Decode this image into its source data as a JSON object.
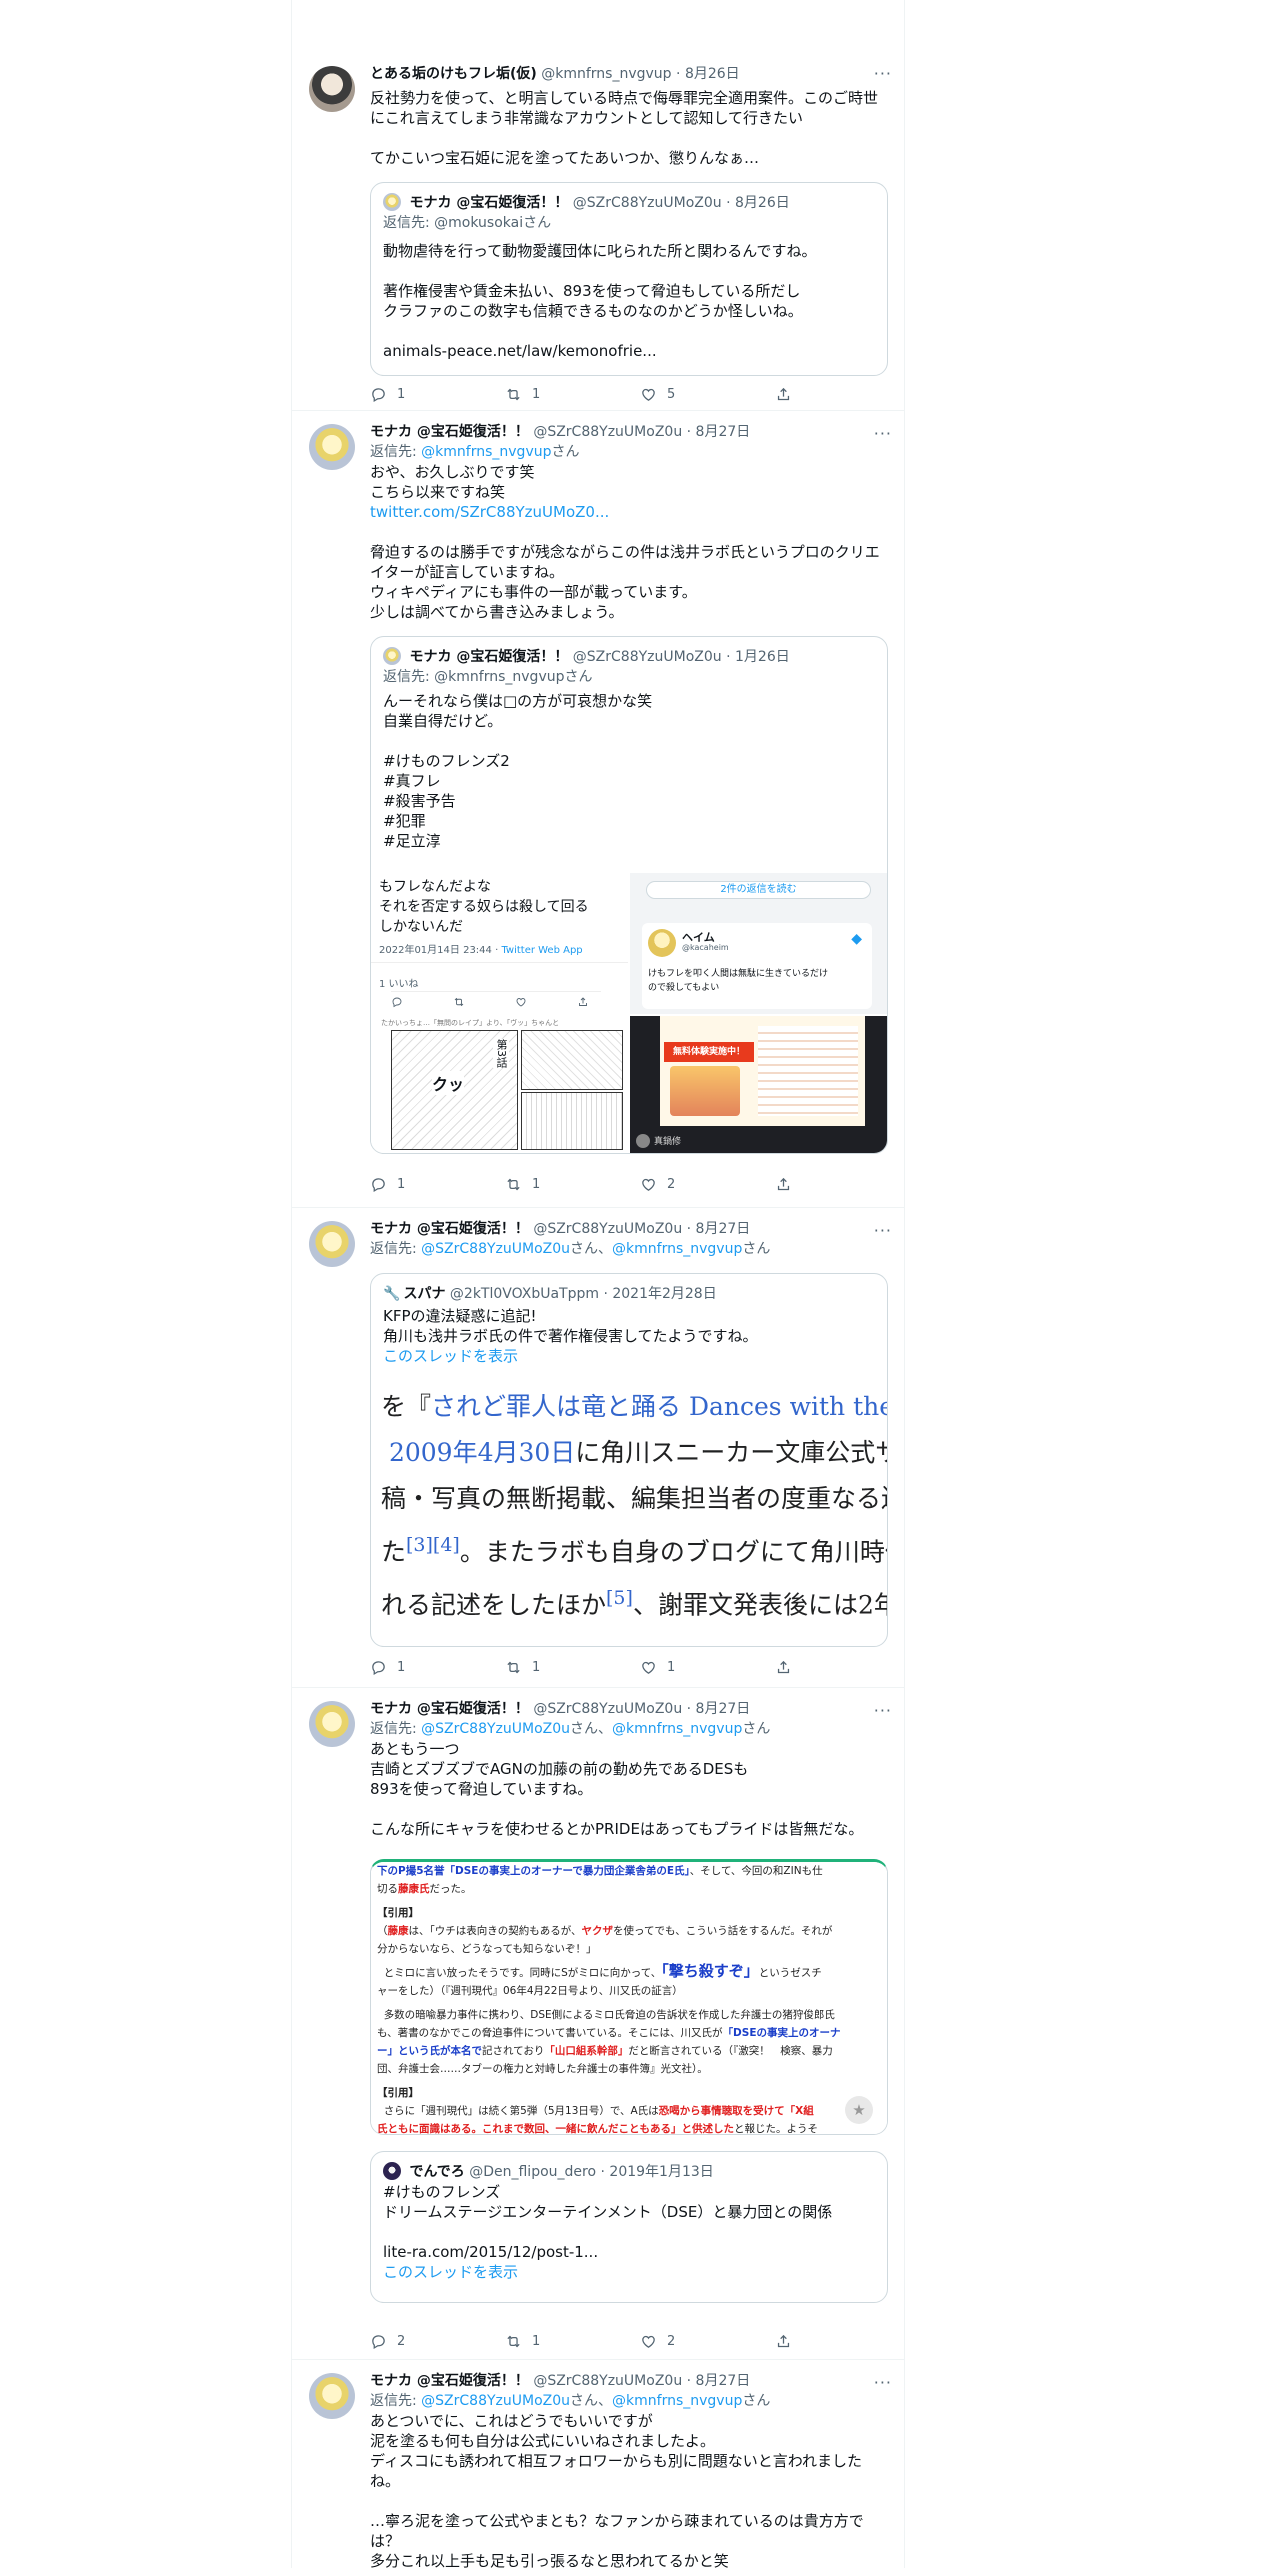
{
  "tweets": [
    {
      "name": "とある垢のけもフレ垢(仮)",
      "handle": "@kmnfrns_nvgvup",
      "date": "8月26日",
      "text": "反社勢力を使って、と明言している時点で侮辱罪完全適用案件。このご時世にこれ言えてしまう非常識なアカウントとして認知して行きたい\n\nてかこいつ宝石姫に泥を塗ってたあいつか、懲りんなぁ…",
      "quote": {
        "name": "モナカ @宝石姫復活！！",
        "handle": "@SZrC88YzuUMoZ0u",
        "date": "8月26日",
        "reply_to_prefix": "返信先: ",
        "reply_to": "@mokusokai",
        "reply_suffix": "さん",
        "text": "動物虐待を行って動物愛護団体に叱られた所と関わるんですね。\n\n著作権侵害や賃金未払い、893を使って脅迫もしている所だし\nクラファのこの数字も信頼できるものなのかどうか怪しいね。\n\nanimals-peace.net/law/kemonofrie..."
      },
      "counts": {
        "reply": "1",
        "retweet": "1",
        "like": "5"
      }
    },
    {
      "name": "モナカ @宝石姫復活！！",
      "handle": "@SZrC88YzuUMoZ0u",
      "date": "8月27日",
      "reply_to_prefix": "返信先: ",
      "reply_to": "@kmnfrns_nvgvup",
      "reply_suffix": "さん",
      "text_a": "おや、お久しぶりです笑\nこちら以来ですね笑",
      "link": "twitter.com/SZrC88YzuUMoZ0...",
      "text_b": "脅迫するのは勝手ですが残念ながらこの件は浅井ラボ氏というプロのクリエイターが証言していますね。\nウィキペディアにも事件の一部が載っています。\n少しは調べてから書き込みましょう。",
      "quote": {
        "name": "モナカ @宝石姫復活！！",
        "handle": "@SZrC88YzuUMoZ0u",
        "date": "1月26日",
        "reply_to_prefix": "返信先: ",
        "reply_to": "@kmnfrns_nvgvup",
        "reply_suffix": "さん",
        "text": "んーそれなら僕は□の方が可哀想かな笑\n自業自得だけど。\n\n#けものフレンズ2\n#真フレ\n#殺害予告\n#犯罪\n#足立淳",
        "img1_text": "もフレなんだよな\nそれを否定する奴らは殺して回る\nしかないんだ",
        "img1_time": "2022年01月14日 23:44 · ",
        "img1_app": "Twitter Web App",
        "img1_likes": "1 いいね",
        "img2_button": "2件の返信を読む",
        "img2_name": "ヘイム",
        "img2_handle": "@kacaheim",
        "img2_text": "けもフレを叩く人間は無駄に生きているだけ\nので殺してもよい",
        "img3_caption": "たかいっちょ…「無問のレイプ」より、「ヴッ」ちゃんと",
        "img3_manga": "第3話",
        "img3_sfx": "クッ",
        "img4_banner": "無料体験実施中！",
        "img4_name": "真鍋修"
      },
      "counts": {
        "reply": "1",
        "retweet": "1",
        "like": "2"
      }
    },
    {
      "name": "モナカ @宝石姫復活！！",
      "handle": "@SZrC88YzuUMoZ0u",
      "date": "8月27日",
      "reply_to_prefix": "返信先: ",
      "reply_to": "@SZrC88YzuUMoZ0u",
      "reply_mid": "さん、",
      "reply_to2": "@kmnfrns_nvgvup",
      "reply_suffix": "さん",
      "quote": {
        "name": "スパナ",
        "handle": "@2kTl0VOXbUaTppm",
        "date": "2021年2月28日",
        "text": "KFPの違法疑惑に追記!\n角川も浅井ラボ氏の件で著作権侵害してたようですね。",
        "thread_link": "このスレッドを表示",
        "wiki": {
          "l1a": "を『",
          "l1b": "されど罪人は竜と踊る Dances with the D",
          "l2a": "2009年4月30日",
          "l2b": "に角川スニーカー文庫公式サ",
          "l3": "稿・写真の無断掲載、編集担当者の度重なる過",
          "l4a": "た",
          "l4b": "[3][4]",
          "l4c": "。またラボも自身のブログにて角川時代の",
          "l5a": "れる記述をしたほか",
          "l5b": "[5]",
          "l5c": "、謝罪文発表後には2年"
        }
      },
      "counts": {
        "reply": "1",
        "retweet": "1",
        "like": "1"
      }
    },
    {
      "name": "モナカ @宝石姫復活！！",
      "handle": "@SZrC88YzuUMoZ0u",
      "date": "8月27日",
      "reply_to_prefix": "返信先: ",
      "reply_to": "@SZrC88YzuUMoZ0u",
      "reply_mid": "さん、",
      "reply_to2": "@kmnfrns_nvgvup",
      "reply_suffix": "さん",
      "text": "あともう一つ\n吉崎とズブズブでAGNの加藤の前の勤め先であるDESも\n893を使って脅迫していますね。\n\nこんな所にキャラを使わせるとかPRIDEはあってもプライドは皆無だな。",
      "article": {
        "a1": "下のP撮5名誉",
        "a2": "「DSEの事実上のオーナーで暴力団企業舎弟のE氏」",
        "a3": "、そして、今回の和ZINも仕",
        "a4": "切る",
        "a5": "藤康氏",
        "a6": "だった。",
        "h1": "【引用】",
        "b1a": "（",
        "b1b": "藤康",
        "b1c": "は、「ウチは表向きの契約もあるが、",
        "b1d": "ヤクザ",
        "b1e": "を使ってでも、こういう話をするんだ。それが",
        "b2": "分からないなら、どうなっても知らないぞ！」",
        "c1a": "とミロに言い放ったそうです。同時にSがミロに向かって、",
        "c1b": "「撃ち殺すぞ」",
        "c1c": "というゼスチ",
        "c2": "ャーをした）（『週刊現代』06年4月22日号より、川又氏の証言）",
        "d1": "多数の暗喩暴力事件に携わり、DSE側によるミロ氏脅迫の告訴状を作成した弁護士の猪狩俊郎氏",
        "d2a": "も、著書のなかでこの脅迫事件について書いている。そこには、川又氏が",
        "d2b": "「DSEの事実上のオーナ",
        "d3a": "ー」という氏が本名で",
        "d3b": "記されており",
        "d3c": "「山口組系幹部」",
        "d3d": "だと断言されている（『激突！　検察、暴力",
        "d4": "団、弁護士会……タブーの権力と対峙した弁護士の事件簿』光文社）。",
        "h2": "【引用】",
        "e1a": "さらに「週刊現代」は続く第5弾（5月13日号）で、A氏は",
        "e1b": "恐喝から事情聴取を受けて「X組",
        "e2": "氏ともに面識はある。これまで数回、一緒に飲んだこともある」と供述した",
        "e3": "と報じた。ようそ"
      },
      "quote": {
        "name": "でんでろ",
        "handle": "@Den_flipou_dero",
        "date": "2019年1月13日",
        "text": "#けものフレンズ\nドリームステージエンターテインメント（DSE）と暴力団との関係\n\nlite-ra.com/2015/12/post-1...",
        "thread_link": "このスレッドを表示"
      },
      "counts": {
        "reply": "2",
        "retweet": "1",
        "like": "2"
      }
    },
    {
      "name": "モナカ @宝石姫復活！！",
      "handle": "@SZrC88YzuUMoZ0u",
      "date": "8月27日",
      "reply_to_prefix": "返信先: ",
      "reply_to": "@SZrC88YzuUMoZ0u",
      "reply_mid": "さん、",
      "reply_to2": "@kmnfrns_nvgvup",
      "reply_suffix": "さん",
      "text": "あとついでに、これはどうでもいいですが\n泥を塗るも何も自分は公式にいいねされましたよ。\nディスコにも誘われて相互フォロワーからも別に問題ないと言われましたね。\n\n…寧ろ泥を塗って公式やまとも？なファンから疎まれているのは貴方方では？\n多分これ以上手も足も引っ張るなと思われてるかと笑"
    }
  ],
  "sep": " · ",
  "more_glyph": "···",
  "icons": [
    "reply-icon",
    "retweet-icon",
    "like-icon",
    "share-icon",
    "more-icon",
    "verified-badge-icon",
    "star-icon"
  ],
  "colors": {
    "link": "#1d9bf0",
    "muted": "#536471",
    "border": "#cfd9de"
  }
}
